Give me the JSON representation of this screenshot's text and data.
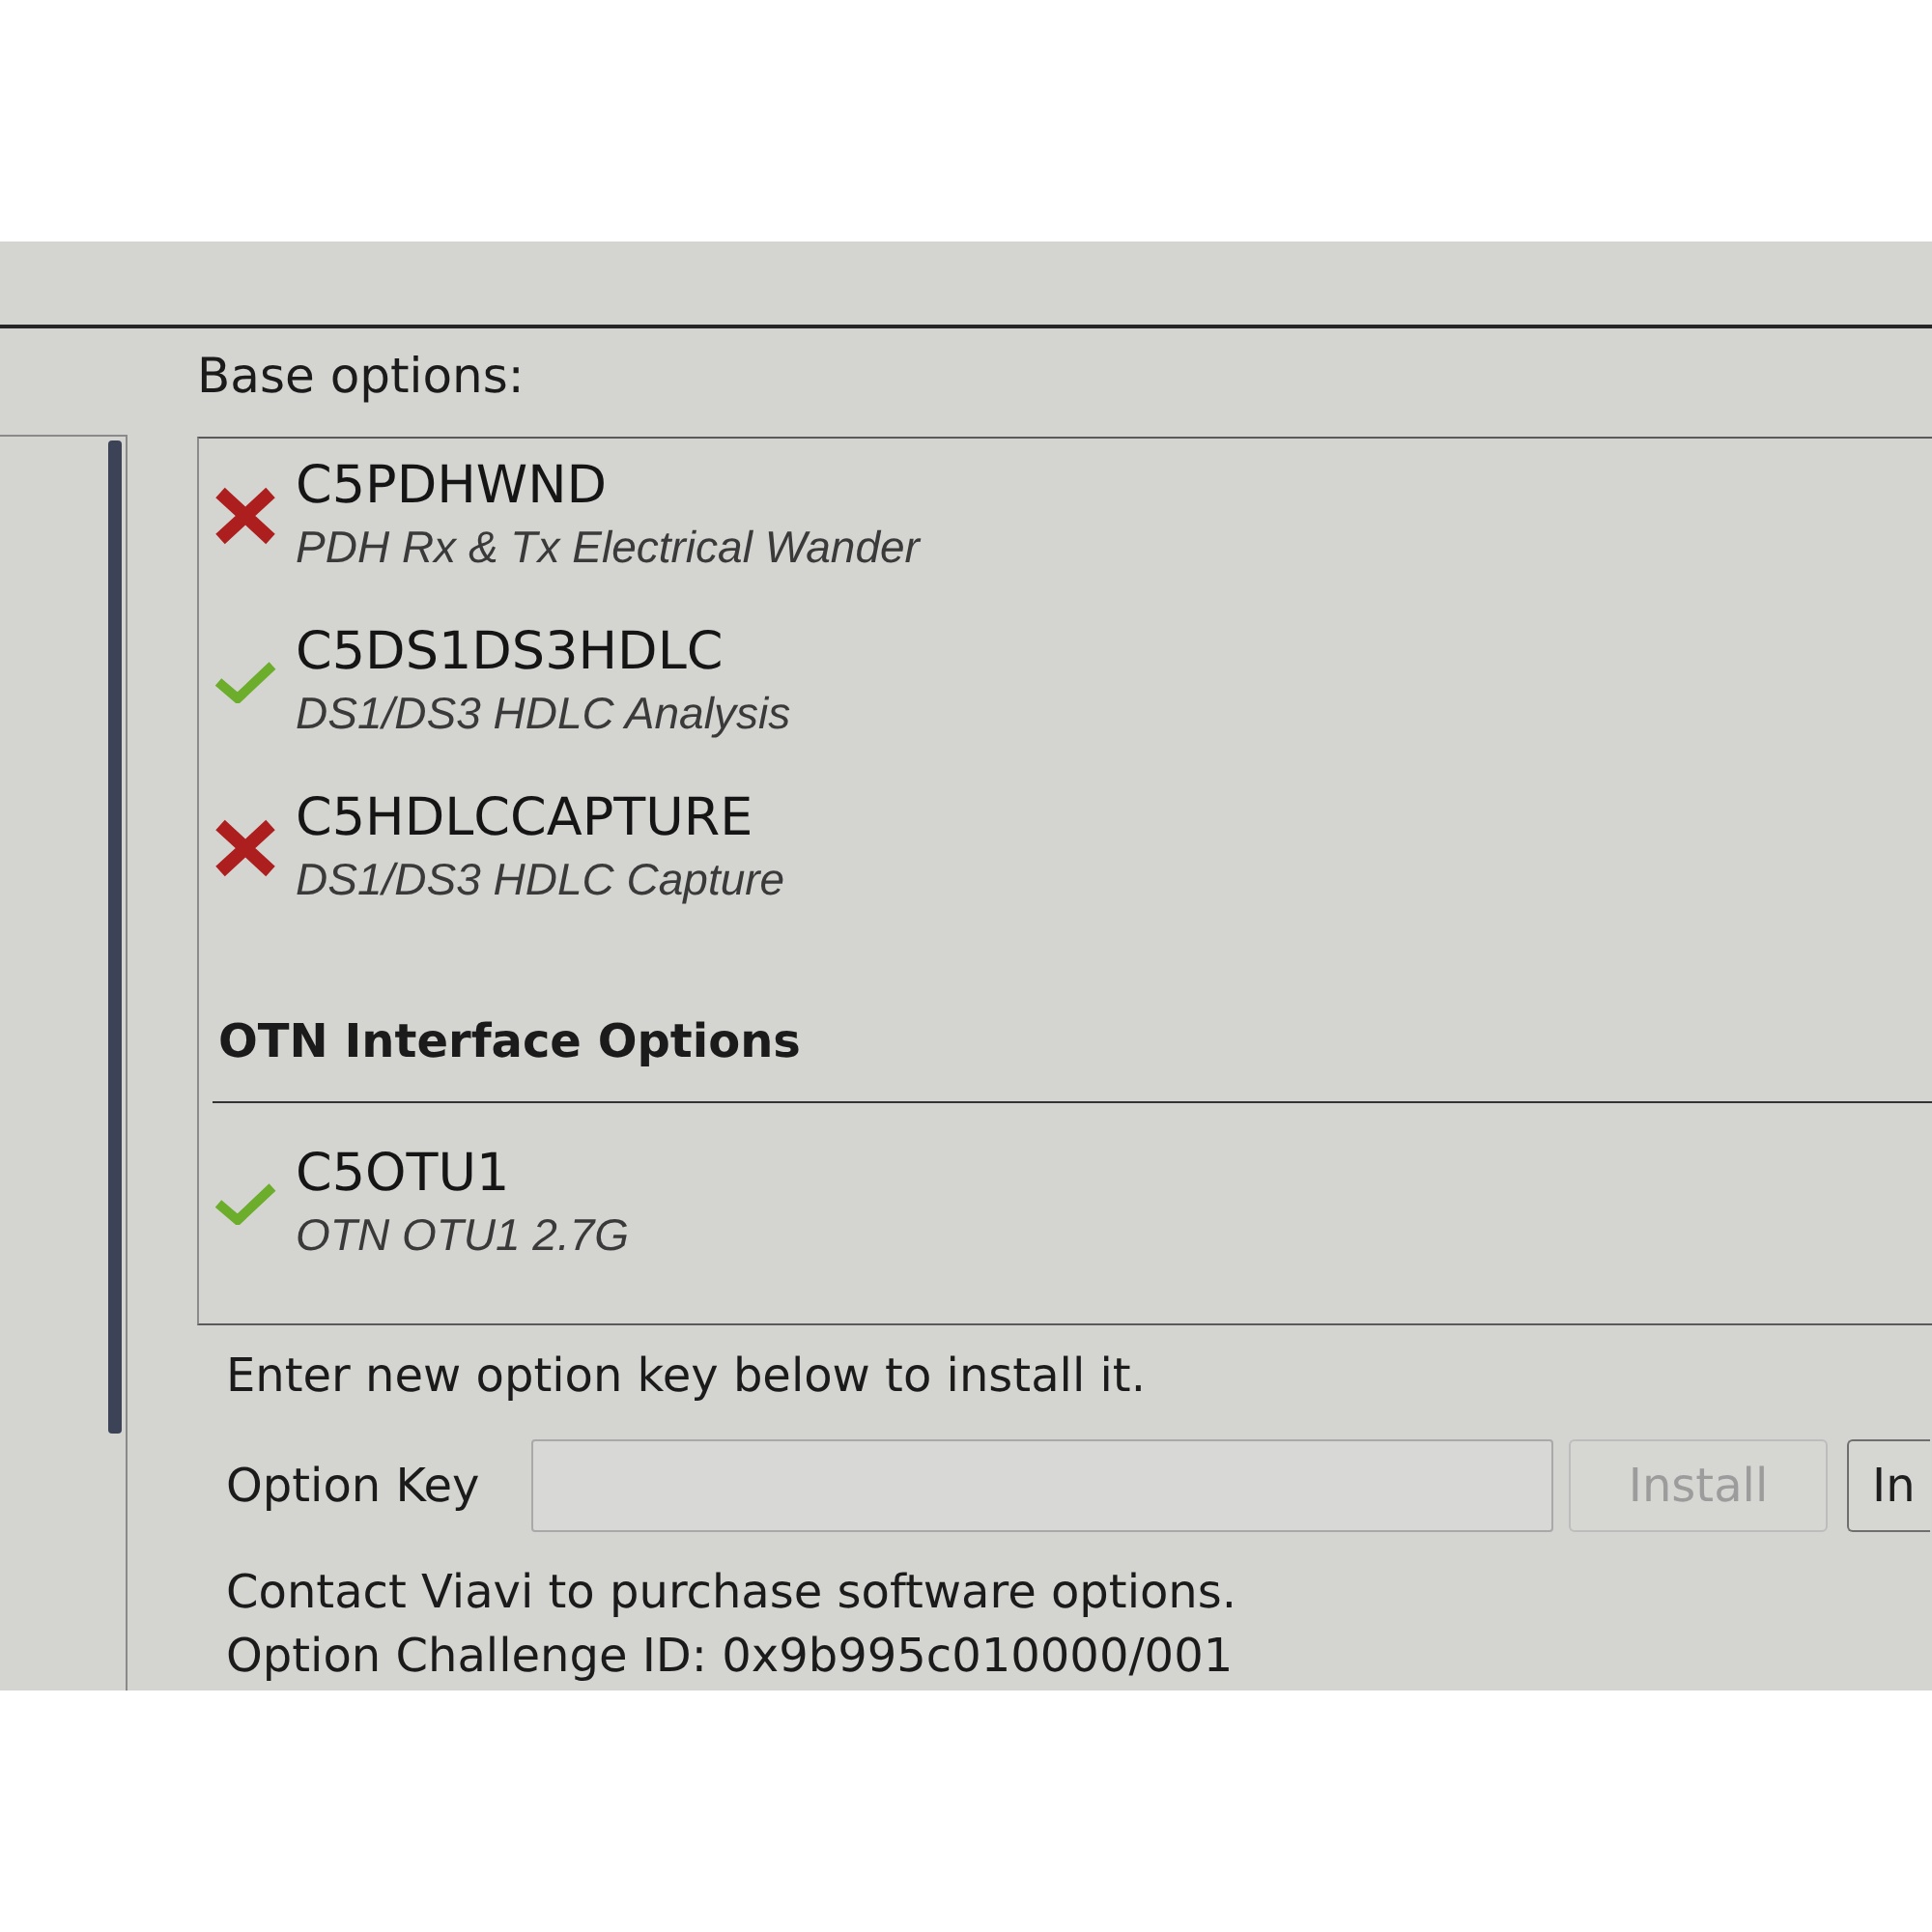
{
  "base_options_label": "Base options:",
  "option_groups": [
    {
      "items": [
        {
          "code": "C5PDHWND",
          "description": "PDH Rx & Tx Electrical Wander",
          "installed": false
        },
        {
          "code": "C5DS1DS3HDLC",
          "description": "DS1/DS3 HDLC Analysis",
          "installed": true
        },
        {
          "code": "C5HDLCCAPTURE",
          "description": "DS1/DS3 HDLC Capture",
          "installed": false
        }
      ]
    },
    {
      "title": "OTN Interface Options",
      "items": [
        {
          "code": "C5OTU1",
          "description": "OTN OTU1 2.7G",
          "installed": true
        }
      ]
    }
  ],
  "install_instruction": "Enter new option key below to install it.",
  "option_key": {
    "label": "Option Key"
  },
  "buttons": [
    {
      "label": "Install",
      "disabled": true
    },
    {
      "label": "In",
      "disabled": false
    }
  ],
  "footer_lines": [
    "Contact Viavi to purchase software options.",
    "Option Challenge ID: 0x9b995c010000/001"
  ]
}
